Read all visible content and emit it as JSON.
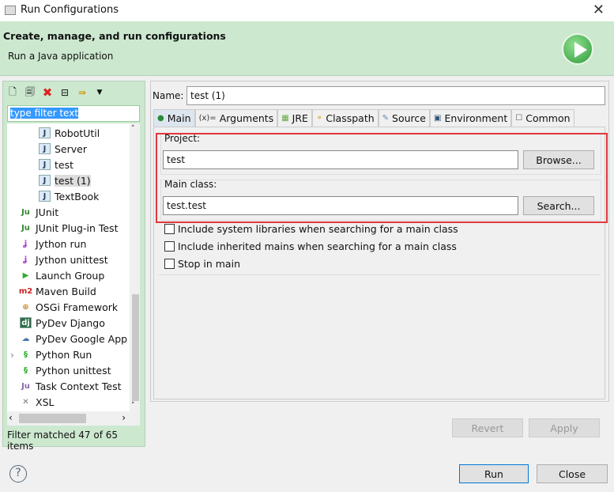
{
  "window": {
    "title": "Run Configurations",
    "close": "✕"
  },
  "header": {
    "title": "Create, manage, and run configurations",
    "subtitle": "Run a Java application"
  },
  "sidebar": {
    "filter_value": "type filter text",
    "items": [
      {
        "label": "RobotUtil",
        "icon": "java-class-icon",
        "indent": 2
      },
      {
        "label": "Server",
        "icon": "java-class-icon",
        "indent": 2
      },
      {
        "label": "test",
        "icon": "java-class-icon",
        "indent": 2
      },
      {
        "label": "test (1)",
        "icon": "java-class-icon",
        "indent": 2,
        "selected": true
      },
      {
        "label": "TextBook",
        "icon": "java-class-icon",
        "indent": 2
      },
      {
        "label": "JUnit",
        "icon": "junit-icon",
        "indent": 1
      },
      {
        "label": "JUnit Plug-in Test",
        "icon": "junit-plugin-icon",
        "indent": 1
      },
      {
        "label": "Jython run",
        "icon": "jython-icon",
        "indent": 1
      },
      {
        "label": "Jython unittest",
        "icon": "jython-unittest-icon",
        "indent": 1
      },
      {
        "label": "Launch Group",
        "icon": "launch-group-icon",
        "indent": 1
      },
      {
        "label": "Maven Build",
        "icon": "maven-icon",
        "indent": 1
      },
      {
        "label": "OSGi Framework",
        "icon": "osgi-icon",
        "indent": 1
      },
      {
        "label": "PyDev Django",
        "icon": "django-icon",
        "indent": 1
      },
      {
        "label": "PyDev Google App",
        "icon": "google-app-icon",
        "indent": 1
      },
      {
        "label": "Python Run",
        "icon": "python-icon",
        "indent": 1,
        "expandable": true
      },
      {
        "label": "Python unittest",
        "icon": "python-unittest-icon",
        "indent": 1
      },
      {
        "label": "Task Context Test",
        "icon": "task-context-icon",
        "indent": 1
      },
      {
        "label": "XSL",
        "icon": "xsl-icon",
        "indent": 1
      }
    ],
    "status": "Filter matched 47 of 65 items"
  },
  "main": {
    "name_label": "Name:",
    "name_value": "test (1)",
    "tabs": [
      {
        "label": "Main",
        "icon": "main-icon"
      },
      {
        "label": "Arguments",
        "icon": "arguments-icon"
      },
      {
        "label": "JRE",
        "icon": "jre-icon"
      },
      {
        "label": "Classpath",
        "icon": "classpath-icon"
      },
      {
        "label": "Source",
        "icon": "source-icon"
      },
      {
        "label": "Environment",
        "icon": "environment-icon"
      },
      {
        "label": "Common",
        "icon": "common-icon"
      }
    ],
    "project_label": "Project:",
    "project_value": "test",
    "browse": "Browse...",
    "mainclass_label": "Main class:",
    "mainclass_value": "test.test",
    "search": "Search...",
    "checkboxes": [
      "Include system libraries when searching for a main class",
      "Include inherited mains when searching for a main class",
      "Stop in main"
    ],
    "revert": "Revert",
    "apply": "Apply"
  },
  "footer": {
    "help": "?",
    "run": "Run",
    "close": "Close"
  },
  "colors": {
    "header_bg": "#cce8cf",
    "highlight_box": "#e0383e",
    "selection": "#3399ff"
  }
}
